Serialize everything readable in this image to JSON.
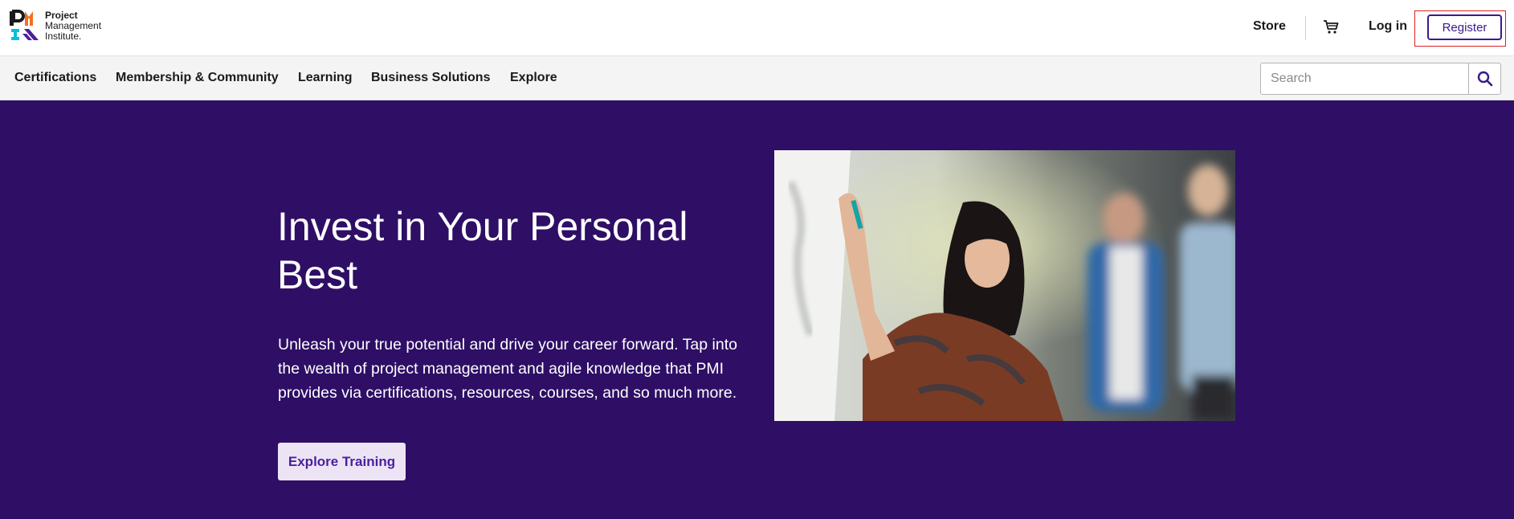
{
  "header": {
    "logo": {
      "line1": "Project",
      "line2": "Management",
      "line3": "Institute."
    },
    "store_label": "Store",
    "cart_icon": "cart-icon",
    "login_label": "Log in",
    "register_label": "Register"
  },
  "nav": {
    "items": [
      {
        "label": "Certifications"
      },
      {
        "label": "Membership & Community"
      },
      {
        "label": "Learning"
      },
      {
        "label": "Business Solutions"
      },
      {
        "label": "Explore"
      }
    ],
    "search": {
      "placeholder": "Search",
      "icon": "search-icon"
    }
  },
  "hero": {
    "title": "Invest in Your Personal Best",
    "body": "Unleash your true potential and drive your career forward. Tap into the wealth of project management and agile knowledge that PMI provides via certifications, resources, courses, and so much more.",
    "cta_label": "Explore Training",
    "photo": "woman-writing-on-whiteboard-photo",
    "background_color": "#2e0f65",
    "cta_color": "#4b1f9e"
  },
  "colors": {
    "brand_purple": "#3b1a8c",
    "highlight_red": "#e02020"
  }
}
